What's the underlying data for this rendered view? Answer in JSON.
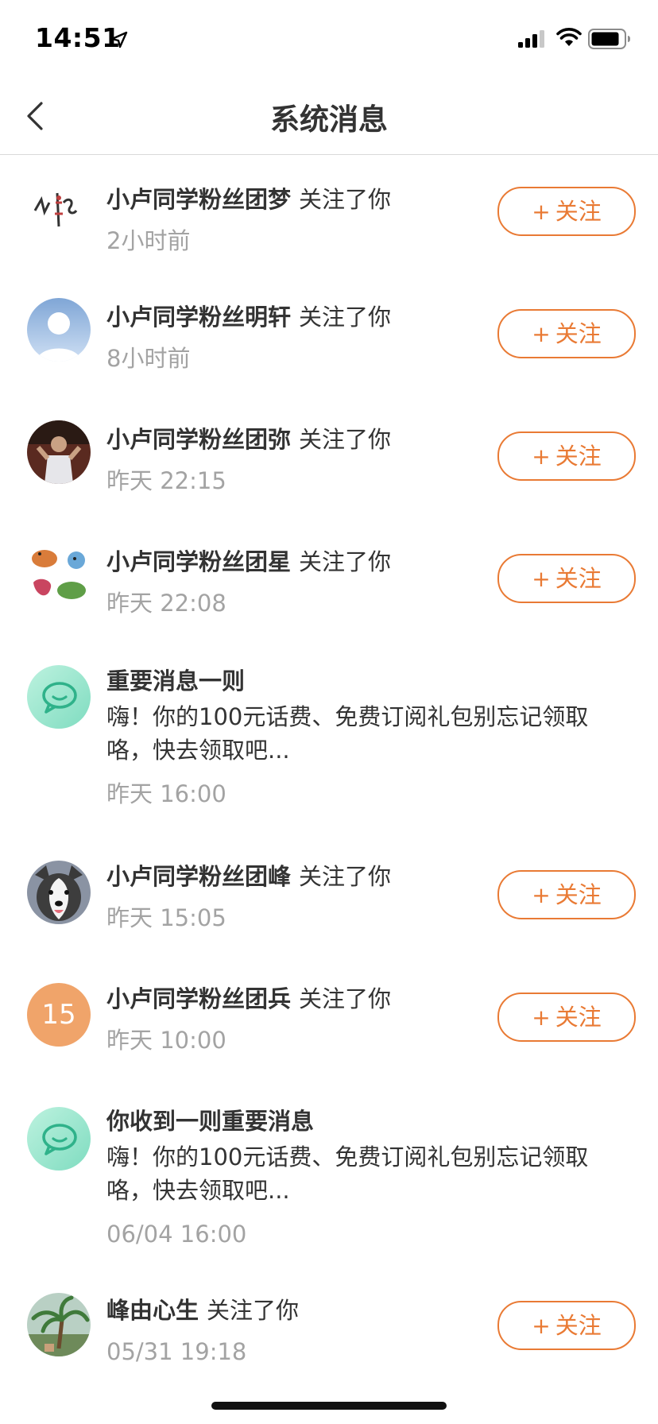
{
  "status_bar": {
    "time": "14:51",
    "icons": [
      "location-arrow-icon",
      "signal-icon",
      "wifi-icon",
      "battery-icon"
    ]
  },
  "nav": {
    "title": "系统消息",
    "back_icon": "chevron-left-icon"
  },
  "accent_color": "#e97a34",
  "follow_label": "关注",
  "follow_plus": "+",
  "items": [
    {
      "type": "follow",
      "name": "小卢同学粉丝团梦",
      "action": "关注了你",
      "time": "2小时前",
      "avatar": "doodle-avatar"
    },
    {
      "type": "follow",
      "name": "小卢同学粉丝明轩",
      "action": "关注了你",
      "time": "8小时前",
      "avatar": "default-avatar"
    },
    {
      "type": "follow",
      "name": "小卢同学粉丝团弥",
      "action": "关注了你",
      "time": "昨天 22:15",
      "avatar": "photo-avatar"
    },
    {
      "type": "follow",
      "name": "小卢同学粉丝团星",
      "action": "关注了你",
      "time": "昨天 22:08",
      "avatar": "illustration-avatar"
    },
    {
      "type": "system",
      "title": "重要消息一则",
      "body": "嗨！你的100元话费、免费订阅礼包别忘记领取咯，快去领取吧...",
      "time": "昨天 16:00",
      "avatar": "system-chat-icon"
    },
    {
      "type": "follow",
      "name": "小卢同学粉丝团峰",
      "action": "关注了你",
      "time": "昨天 15:05",
      "avatar": "husky-avatar"
    },
    {
      "type": "follow",
      "name": "小卢同学粉丝团兵",
      "action": "关注了你",
      "time": "昨天 10:00",
      "avatar": "number-avatar",
      "avatar_text": "15"
    },
    {
      "type": "system",
      "title": "你收到一则重要消息",
      "body": "嗨！你的100元话费、免费订阅礼包别忘记领取咯，快去领取吧...",
      "time": "06/04 16:00",
      "avatar": "system-chat-icon"
    },
    {
      "type": "follow",
      "name": "峰由心生",
      "action": "关注了你",
      "time": "05/31 19:18",
      "avatar": "palm-tree-avatar"
    }
  ]
}
